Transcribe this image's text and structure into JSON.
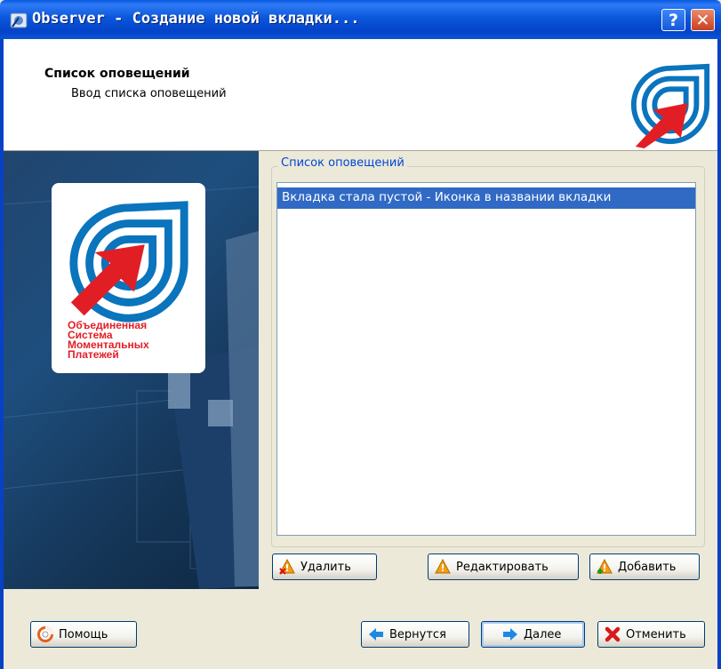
{
  "window": {
    "title": "Observer - Создание новой вкладки...",
    "help_glyph": "?",
    "close_glyph": "✕"
  },
  "header": {
    "title": "Список оповещений",
    "subtitle": "Ввод списка оповещений"
  },
  "brand": {
    "text_lines": [
      "Объединенная",
      "Система",
      "Моментальных",
      "Платежей"
    ],
    "colors": {
      "blue": "#0a74bd",
      "red": "#e21e25"
    }
  },
  "alerts": {
    "group_label": "Список оповещений",
    "items": [
      "Вкладка стала пустой - Иконка в названии вкладки"
    ],
    "buttons": {
      "delete": "Удалить",
      "edit": "Редактировать",
      "add": "Добавить"
    }
  },
  "footer": {
    "help": "Помощь",
    "back": "Вернутся",
    "next": "Далее",
    "cancel": "Отменить"
  },
  "icons": {
    "app": "observer-app-icon",
    "delete": "warning-delete-icon",
    "edit": "warning-icon",
    "add": "warning-add-icon",
    "help": "lifebuoy-icon",
    "back": "arrow-left-icon",
    "next": "arrow-right-icon",
    "cancel": "red-x-icon"
  }
}
